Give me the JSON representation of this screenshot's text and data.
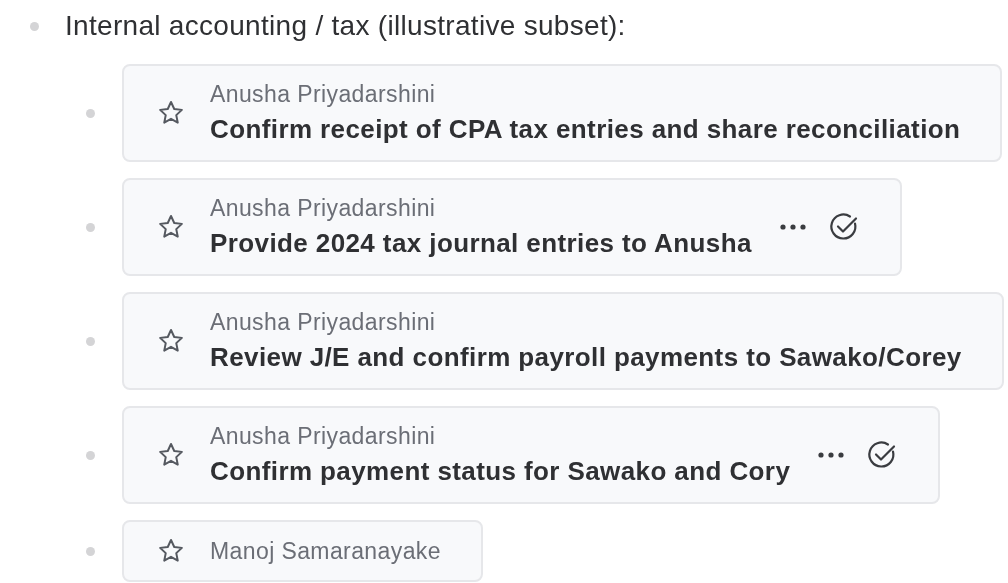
{
  "heading": "Internal accounting / tax (illustrative subset):",
  "tasks": [
    {
      "author": "Anusha Priyadarshini",
      "title": "Confirm receipt of CPA tax entries and share reconciliation",
      "actions": false
    },
    {
      "author": "Anusha Priyadarshini",
      "title": "Provide 2024 tax journal entries to Anusha",
      "actions": true
    },
    {
      "author": "Anusha Priyadarshini",
      "title": "Review J/E and confirm payroll payments to Sawako/Corey",
      "actions": false
    },
    {
      "author": "Anusha Priyadarshini",
      "title": "Confirm payment status for Sawako and Cory",
      "actions": true
    },
    {
      "author": "Manoj Samaranayake",
      "actions": false
    }
  ]
}
